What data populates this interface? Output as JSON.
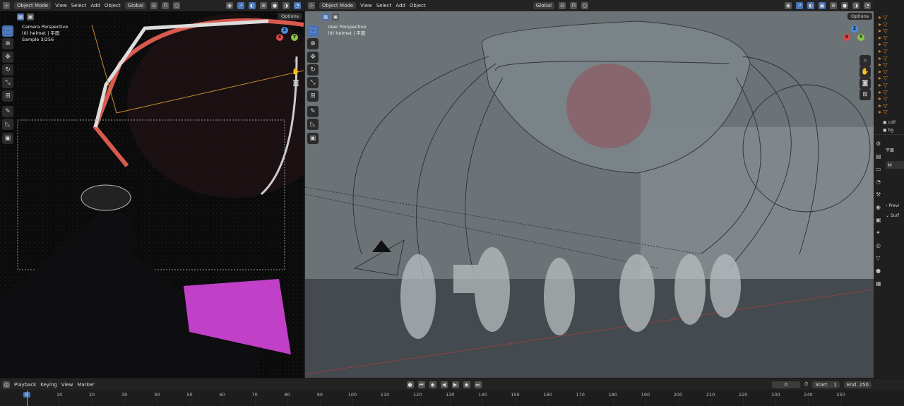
{
  "left_viewport": {
    "mode": "Object Mode",
    "menus": [
      "View",
      "Select",
      "Add",
      "Object"
    ],
    "orientation": "Global",
    "options": "Options",
    "overlay": [
      "Camera Perspective",
      "(0) helmet | 平面",
      "Sample 3/256"
    ]
  },
  "right_viewport": {
    "mode": "Object Mode",
    "menus": [
      "View",
      "Select",
      "Add",
      "Object"
    ],
    "orientation": "Global",
    "options": "Options",
    "overlay": [
      "User Perspective",
      "(0) helmet | 平面"
    ]
  },
  "gizmo": {
    "x": "X",
    "y": "Y",
    "z": "Z"
  },
  "outliner": {
    "items": [
      "coll",
      "bg"
    ]
  },
  "properties": {
    "items": [
      "平面",
      "材",
      "Previ",
      "Surf"
    ]
  },
  "timeline": {
    "menus": [
      "Playback",
      "Keying",
      "View",
      "Marker"
    ],
    "current_frame": "0",
    "start_label": "Start",
    "start": "1",
    "end_label": "End",
    "end": "250",
    "ticks": [
      0,
      10,
      20,
      30,
      40,
      50,
      60,
      70,
      80,
      90,
      100,
      110,
      120,
      130,
      140,
      150,
      160,
      170,
      180,
      190,
      200,
      210,
      220,
      230,
      240,
      250
    ]
  },
  "colors": {
    "accent": "#4772b3",
    "magenta": "#c040c8"
  }
}
